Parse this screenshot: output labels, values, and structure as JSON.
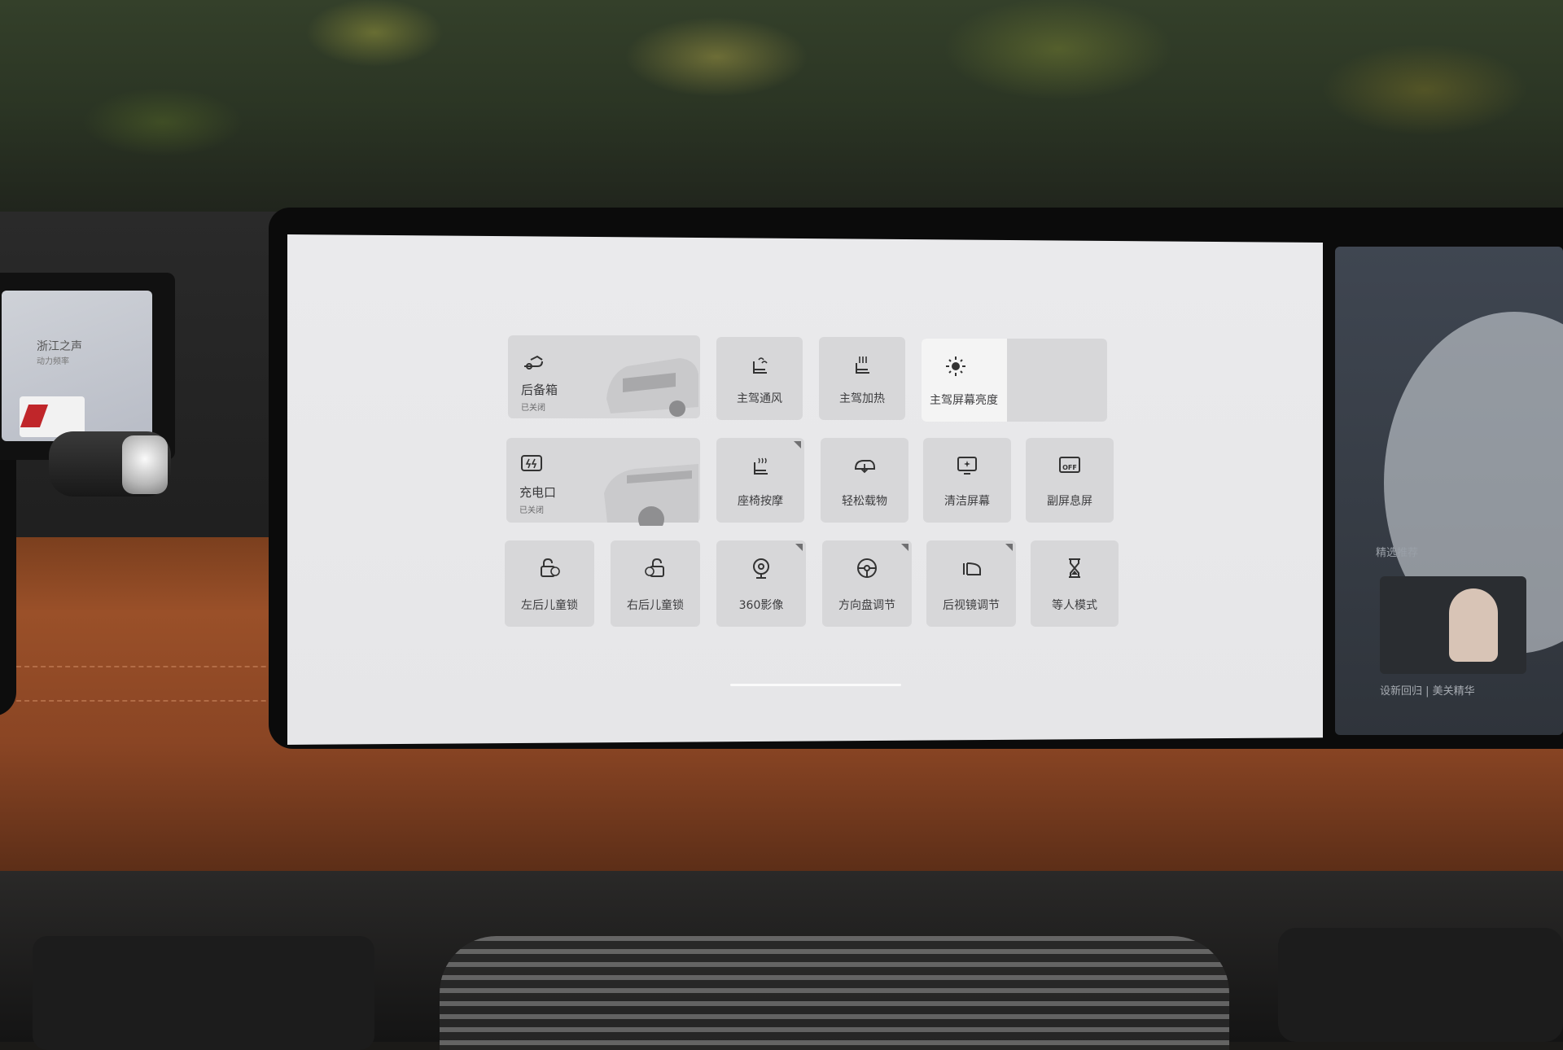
{
  "left_display": {
    "title": "浙江之声",
    "subtitle": "动力频率"
  },
  "right_display": {
    "tag": "精选推荐",
    "caption": "设新回归 | 美关精华"
  },
  "controls": {
    "trunk": {
      "title": "后备箱",
      "status": "已关闭"
    },
    "charge_port": {
      "title": "充电口",
      "status": "已关闭"
    },
    "row1": [
      {
        "label": "主驾通风",
        "icon": "seat-ventilation-icon"
      },
      {
        "label": "主驾加热",
        "icon": "seat-heating-icon"
      },
      {
        "label": "主驾屏幕亮度",
        "icon": "brightness-icon"
      }
    ],
    "row2": [
      {
        "label": "座椅按摩",
        "icon": "seat-massage-icon"
      },
      {
        "label": "轻松载物",
        "icon": "cargo-icon"
      },
      {
        "label": "清洁屏幕",
        "icon": "clean-screen-icon"
      },
      {
        "label": "副屏息屏",
        "icon": "screen-off-icon"
      }
    ],
    "row3": [
      {
        "label": "左后儿童锁",
        "icon": "child-lock-left-icon"
      },
      {
        "label": "右后儿童锁",
        "icon": "child-lock-right-icon"
      },
      {
        "label": "360影像",
        "icon": "camera-360-icon"
      },
      {
        "label": "方向盘调节",
        "icon": "steering-wheel-icon"
      },
      {
        "label": "后视镜调节",
        "icon": "mirror-icon"
      },
      {
        "label": "等人模式",
        "icon": "hourglass-icon"
      }
    ],
    "screen_off_glyph": "OFF"
  },
  "colors": {
    "screen_bg": "#e8e8ea",
    "tile_bg": "#d7d7d9",
    "tile_active": "#f4f4f4",
    "label": "#3d3d3f"
  }
}
